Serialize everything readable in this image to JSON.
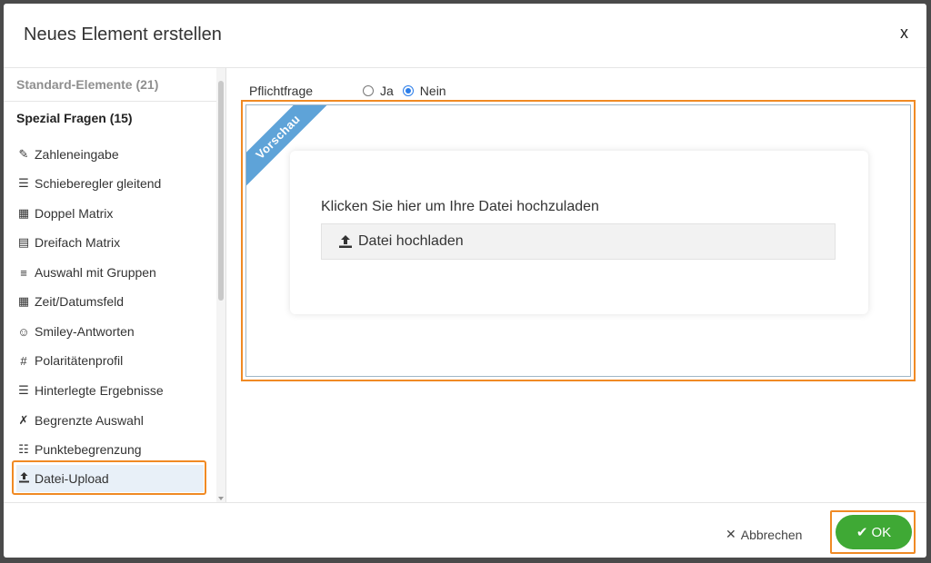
{
  "dialog": {
    "title": "Neues Element erstellen",
    "close_label": "x"
  },
  "sidebar": {
    "group_standard": "Standard-Elemente (21)",
    "group_special": "Spezial Fragen (15)",
    "items": [
      {
        "label": "Zahleneingabe",
        "icon": "pencil-icon"
      },
      {
        "label": "Schieberegler gleitend",
        "icon": "slider-icon"
      },
      {
        "label": "Doppel Matrix",
        "icon": "double-matrix-icon"
      },
      {
        "label": "Dreifach Matrix",
        "icon": "triple-matrix-icon"
      },
      {
        "label": "Auswahl mit Gruppen",
        "icon": "group-list-icon"
      },
      {
        "label": "Zeit/Datumsfeld",
        "icon": "calendar-icon"
      },
      {
        "label": "Smiley-Antworten",
        "icon": "smiley-icon"
      },
      {
        "label": "Polaritätenprofil",
        "icon": "hash-icon"
      },
      {
        "label": "Hinterlegte Ergebnisse",
        "icon": "stored-results-icon"
      },
      {
        "label": "Begrenzte Auswahl",
        "icon": "limited-choice-icon"
      },
      {
        "label": "Punktebegrenzung",
        "icon": "point-limit-icon"
      },
      {
        "label": "Datei-Upload",
        "icon": "upload-icon",
        "active": true
      }
    ]
  },
  "form": {
    "required_label": "Pflichtfrage",
    "options": [
      "Ja",
      "Nein"
    ],
    "selected": "Nein"
  },
  "preview": {
    "ribbon": "Vorschau",
    "question": "Klicken Sie hier um Ihre Datei hochzuladen",
    "upload_label": "Datei hochladen"
  },
  "footer": {
    "cancel_label": "Abbrechen",
    "ok_label": "OK"
  },
  "colors": {
    "highlight": "#f08a24",
    "ok": "#3fa935",
    "ribbon": "#5ea3d8"
  }
}
